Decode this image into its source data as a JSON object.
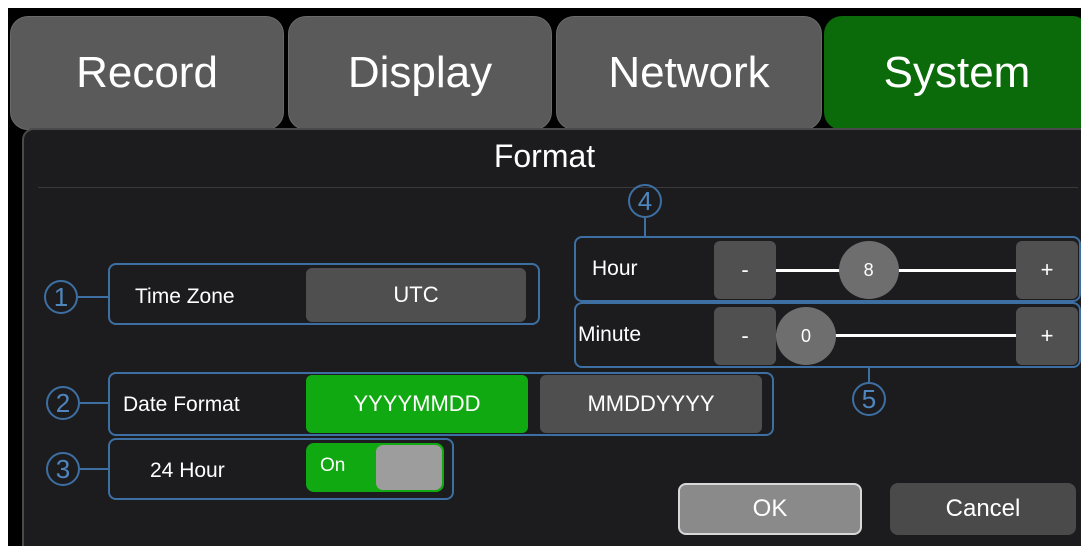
{
  "tabs": [
    {
      "label": "Record",
      "active": false
    },
    {
      "label": "Display",
      "active": false
    },
    {
      "label": "Network",
      "active": false
    },
    {
      "label": "System",
      "active": true
    }
  ],
  "panel": {
    "title": "Format"
  },
  "callouts": [
    "1",
    "2",
    "3",
    "4",
    "5"
  ],
  "time_zone": {
    "label": "Time Zone",
    "value": "UTC"
  },
  "date_format": {
    "label": "Date Format",
    "options": [
      "YYYYMMDD",
      "MMDDYYYY"
    ],
    "selected": "YYYYMMDD"
  },
  "hour_24": {
    "label": "24 Hour",
    "state_label": "On",
    "enabled": true
  },
  "hour": {
    "label": "Hour",
    "value": "8",
    "min": 0,
    "max": 23,
    "minus": "-",
    "plus": "+"
  },
  "minute": {
    "label": "Minute",
    "value": "0",
    "min": 0,
    "max": 59,
    "minus": "-",
    "plus": "+"
  },
  "actions": {
    "ok": "OK",
    "cancel": "Cancel"
  },
  "colors": {
    "active_tab": "#0b6b0b",
    "selected": "#11a911",
    "callout": "#3d6fa3"
  }
}
